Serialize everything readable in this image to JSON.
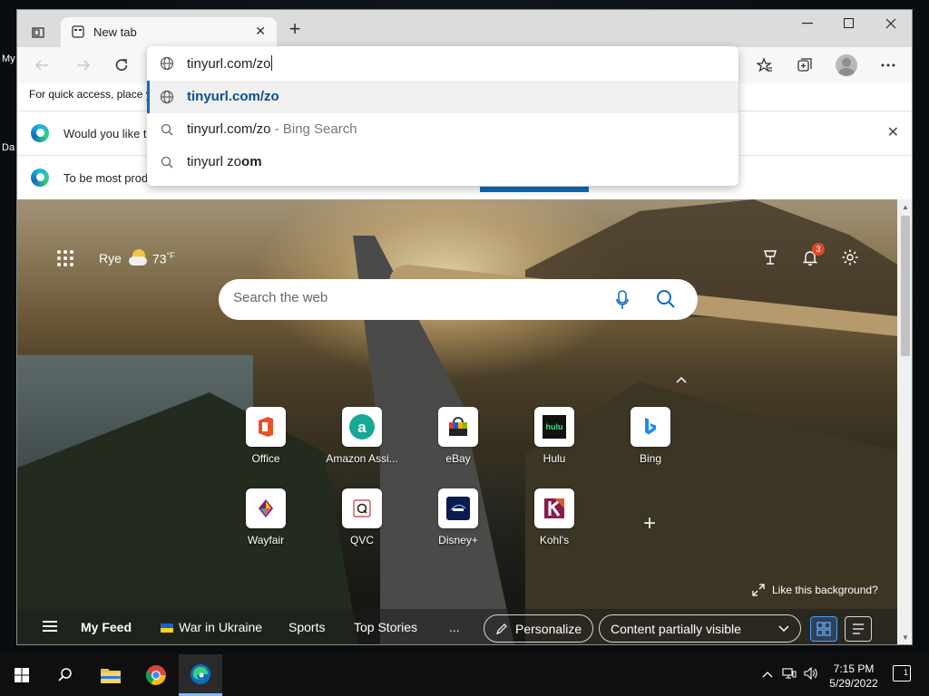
{
  "desktop": {
    "labels": [
      "My",
      "Da"
    ]
  },
  "browser": {
    "tab": {
      "title": "New tab"
    },
    "address": {
      "value": "tinyurl.com/zo"
    },
    "suggestions": [
      {
        "icon": "globe-icon",
        "text": "tinyurl.com/zo",
        "suffix": "",
        "selected": true
      },
      {
        "icon": "search-icon",
        "text": "tinyurl.com/zo",
        "suffix": " - Bing Search",
        "selected": false
      },
      {
        "icon": "search-icon",
        "text_prefix": "tinyurl zo",
        "text_bold": "om",
        "selected": false
      }
    ],
    "favbar_text": "For quick access, place y",
    "infobars": [
      {
        "text": "Would you like t"
      },
      {
        "text": "To be most prod"
      }
    ]
  },
  "ntp": {
    "weather": {
      "city": "Rye",
      "temp": "73",
      "unit": "°F"
    },
    "notifications_count": "3",
    "search": {
      "placeholder": "Search the web"
    },
    "tiles": [
      {
        "label": "Office",
        "icon": "office-icon"
      },
      {
        "label": "Amazon Assi...",
        "icon": "amazon-icon"
      },
      {
        "label": "eBay",
        "icon": "ebay-icon"
      },
      {
        "label": "Hulu",
        "icon": "hulu-icon"
      },
      {
        "label": "Bing",
        "icon": "bing-icon"
      },
      {
        "label": "Wayfair",
        "icon": "wayfair-icon"
      },
      {
        "label": "QVC",
        "icon": "qvc-icon"
      },
      {
        "label": "Disney+",
        "icon": "disney-icon"
      },
      {
        "label": "Kohl's",
        "icon": "kohls-icon"
      }
    ],
    "hulu_logo_text": "hulu",
    "like_background": "Like this background?",
    "feed": {
      "my_feed": "My Feed",
      "items": [
        "War in Ukraine",
        "Sports",
        "Top Stories"
      ],
      "more": "...",
      "personalize": "Personalize",
      "content_visibility": "Content partially visible"
    }
  },
  "taskbar": {
    "time": "7:15 PM",
    "date": "5/29/2022",
    "notification_count": "1"
  },
  "colors": {
    "accent": "#0f6cbd",
    "link": "#0b4f8f",
    "badge": "#e04a2a"
  }
}
